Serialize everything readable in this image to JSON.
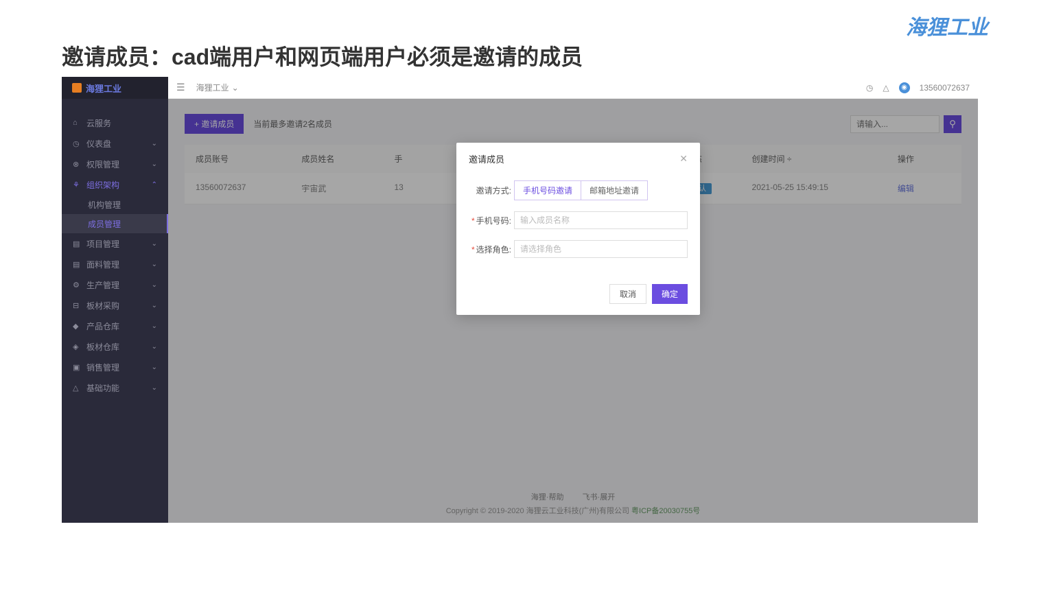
{
  "slide": {
    "title": "邀请成员：cad端用户和网页端用户必须是邀请的成员",
    "brand": "海狸工业"
  },
  "app": {
    "logo_text": "海狸工业",
    "breadcrumb": "海狸工业",
    "user_phone": "13560072637"
  },
  "sidebar": {
    "items": [
      {
        "icon": "⌂",
        "label": "云服务",
        "expand": ""
      },
      {
        "icon": "◷",
        "label": "仪表盘",
        "expand": "⌄"
      },
      {
        "icon": "⊗",
        "label": "权限管理",
        "expand": "⌄"
      },
      {
        "icon": "⚘",
        "label": "组织架构",
        "expand": "⌃",
        "active": true
      },
      {
        "icon": "▤",
        "label": "项目管理",
        "expand": "⌄"
      },
      {
        "icon": "▤",
        "label": "面料管理",
        "expand": "⌄"
      },
      {
        "icon": "⚙",
        "label": "生产管理",
        "expand": "⌄"
      },
      {
        "icon": "⊟",
        "label": "板材采购",
        "expand": "⌄"
      },
      {
        "icon": "◆",
        "label": "产品仓库",
        "expand": "⌄"
      },
      {
        "icon": "◈",
        "label": "板材仓库",
        "expand": "⌄"
      },
      {
        "icon": "▣",
        "label": "销售管理",
        "expand": "⌄"
      },
      {
        "icon": "△",
        "label": "基础功能",
        "expand": "⌄"
      }
    ],
    "sub_org": "机构管理",
    "sub_member": "成员管理"
  },
  "toolbar": {
    "invite_btn": "+ 邀请成员",
    "quota": "当前最多邀请2名成员",
    "search_placeholder": "请输入..."
  },
  "table": {
    "headers": {
      "account": "成员账号",
      "name": "成员姓名",
      "phone": "手",
      "email": "",
      "role": "",
      "status": "状态",
      "time": "创建时间 ÷",
      "action": "操作"
    },
    "rows": [
      {
        "account": "13560072637",
        "name": "宇宙武",
        "phone": "13",
        "status": "默认",
        "time": "2021-05-25 15:49:15",
        "action": "编辑"
      }
    ]
  },
  "modal": {
    "title": "邀请成员",
    "method_label": "邀请方式:",
    "method_phone": "手机号码邀请",
    "method_email": "邮箱地址邀请",
    "phone_label": "手机号码:",
    "phone_placeholder": "输入成员名称",
    "role_label": "选择角色:",
    "role_placeholder": "请选择角色",
    "cancel": "取消",
    "ok": "确定"
  },
  "footer": {
    "link1": "海狸·帮助",
    "link2": "飞书·展开",
    "copyright": "Copyright © 2019-2020 海狸云工业科技(广州)有限公司 ",
    "icp": "粤ICP备20030755号"
  }
}
